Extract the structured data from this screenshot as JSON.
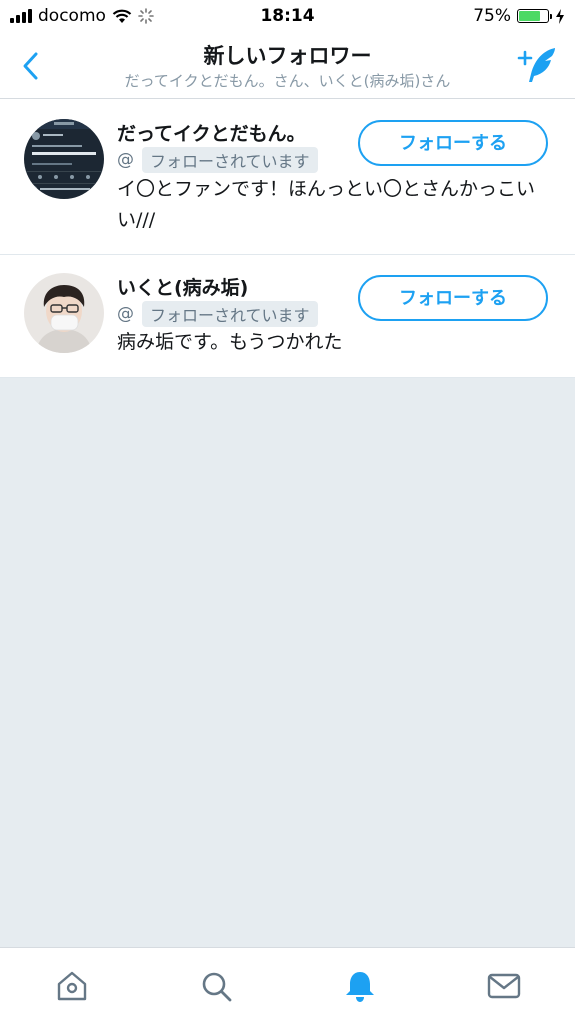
{
  "status_bar": {
    "carrier": "docomo",
    "time": "18:14",
    "battery_percent": "75%",
    "battery_level": 0.75,
    "battery_color": "#4cd964"
  },
  "header": {
    "title": "新しいフォロワー",
    "subtitle": "だってイクとだもん。さん、いくと(病み垢)さん",
    "back_icon": "chevron-left-icon",
    "add_icon": "add-tweet-feather-icon"
  },
  "followers": [
    {
      "name": "だってイクとだもん。",
      "handle_prefix": "@",
      "follows_you": "フォローされています",
      "follow_label": "フォローする",
      "bio": "イ〇とファンです！ほんっとい〇とさんかっこいい///"
    },
    {
      "name": "いくと(病み垢)",
      "handle_prefix": "@",
      "follows_you": "フォローされています",
      "follow_label": "フォローする",
      "bio": "病み垢です。もうつかれた"
    }
  ],
  "tabbar": {
    "items": [
      "home-icon",
      "search-icon",
      "notifications-icon",
      "messages-icon"
    ],
    "active": "notifications-icon"
  },
  "colors": {
    "accent": "#1da1f2",
    "background": "#e6ecf0",
    "muted": "#657786"
  }
}
